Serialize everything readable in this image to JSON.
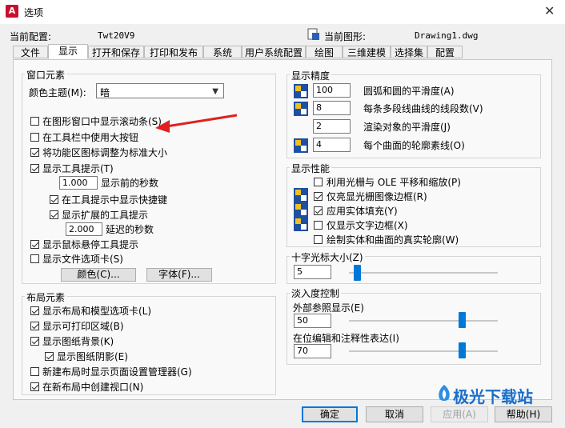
{
  "window": {
    "title": "选项",
    "app_icon": "A"
  },
  "profile": {
    "label": "当前配置:",
    "value": "Twt20V9"
  },
  "drawing": {
    "label": "当前图形:",
    "value": "Drawing1.dwg"
  },
  "tabs": [
    "文件",
    "显示",
    "打开和保存",
    "打印和发布",
    "系统",
    "用户系统配置",
    "绘图",
    "三维建模",
    "选择集",
    "配置"
  ],
  "window_elements": {
    "legend": "窗口元素",
    "color_scheme_label": "颜色主题(M):",
    "color_scheme_value": "暗",
    "scrollbars": "在图形窗口中显示滚动条(S)",
    "large_buttons": "在工具栏中使用大按钮",
    "resize_icons": "将功能区图标调整为标准大小",
    "show_tooltips": "显示工具提示(T)",
    "tooltip_delay_value": "1.000",
    "tooltip_delay_label": "显示前的秒数",
    "shortcut_keys": "在工具提示中显示快捷键",
    "extended_tooltips": "显示扩展的工具提示",
    "extended_delay_value": "2.000",
    "extended_delay_label": "延迟的秒数",
    "rollover_tooltips": "显示鼠标悬停工具提示",
    "file_tabs": "显示文件选项卡(S)",
    "colors_button": "颜色(C)...",
    "fonts_button": "字体(F)..."
  },
  "layout_elements": {
    "legend": "布局元素",
    "layout_model_tabs": "显示布局和模型选项卡(L)",
    "printable_area": "显示可打印区域(B)",
    "paper_background": "显示图纸背景(K)",
    "paper_shadow": "显示图纸阴影(E)",
    "page_setup_manager": "新建布局时显示页面设置管理器(G)",
    "create_viewport": "在新布局中创建视口(N)"
  },
  "display_resolution": {
    "legend": "显示精度",
    "items": [
      {
        "value": "100",
        "label": "圆弧和圆的平滑度(A)"
      },
      {
        "value": "8",
        "label": "每条多段线曲线的线段数(V)"
      },
      {
        "value": "2",
        "label": "渲染对象的平滑度(J)"
      },
      {
        "value": "4",
        "label": "每个曲面的轮廓素线(O)"
      }
    ]
  },
  "display_performance": {
    "legend": "显示性能",
    "items": [
      {
        "label": "利用光栅与 OLE 平移和缩放(P)",
        "checked": false
      },
      {
        "label": "仅亮显光栅图像边框(R)",
        "checked": true
      },
      {
        "label": "应用实体填充(Y)",
        "checked": true
      },
      {
        "label": "仅显示文字边框(X)",
        "checked": false
      },
      {
        "label": "绘制实体和曲面的真实轮廓(W)",
        "checked": false
      }
    ]
  },
  "crosshair": {
    "legend": "十字光标大小(Z)",
    "value": "5",
    "level_percent": 5
  },
  "fade": {
    "legend": "淡入度控制",
    "xref_label": "外部参照显示(E)",
    "xref_value": "50",
    "inplace_label": "在位编辑和注释性表达(I)",
    "inplace_value": "70"
  },
  "footer": {
    "ok": "确定",
    "cancel": "取消",
    "apply": "应用(A)",
    "help": "帮助(H)"
  },
  "watermark": "极光下载站",
  "colors": {
    "accent": "#0078d7",
    "arrow": "#e02020",
    "icon_blue": "#1e4fa0",
    "icon_yellow": "#f0c020"
  }
}
